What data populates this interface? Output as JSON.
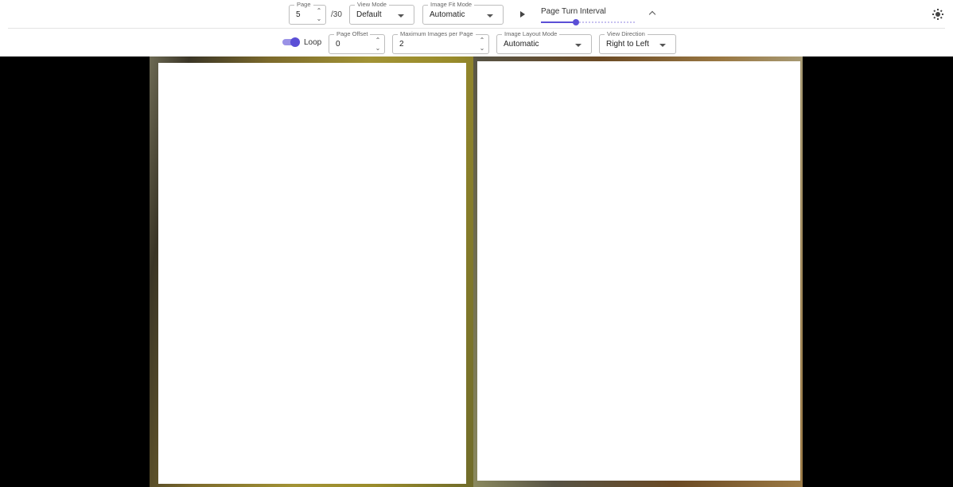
{
  "toolbar": {
    "page": {
      "label": "Page",
      "value": "5",
      "total": "/30"
    },
    "view_mode": {
      "label": "View Mode",
      "value": "Default"
    },
    "image_fit_mode": {
      "label": "Image Fit Mode",
      "value": "Automatic"
    },
    "page_turn_interval": {
      "label": "Page Turn Interval",
      "level_fraction": 0.37
    },
    "loop": {
      "label": "Loop",
      "enabled": true
    },
    "page_offset": {
      "label": "Page Offset",
      "value": "0"
    },
    "max_images_per_page": {
      "label": "Maximum Images per Page",
      "value": "2"
    },
    "image_layout_mode": {
      "label": "Image Layout Mode",
      "value": "Automatic"
    },
    "view_direction": {
      "label": "View Direction",
      "value": "Right to Left"
    }
  },
  "icons": {
    "spin_up": "chevron-up-icon",
    "spin_down": "chevron-down-icon",
    "dropdown": "caret-down-icon",
    "play": "play-icon",
    "collapse": "chevron-up-icon",
    "theme": "sun-icon"
  },
  "colors": {
    "accent": "#5b4fd6",
    "accent_light": "#9a92e6",
    "viewer_background": "#000000",
    "toolbar_background": "#ffffff"
  }
}
